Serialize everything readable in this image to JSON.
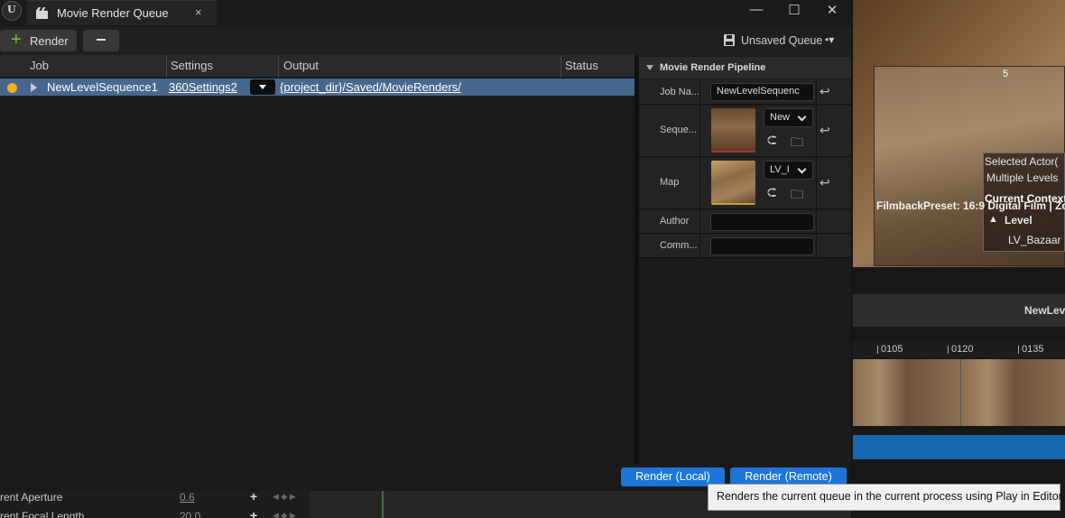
{
  "window": {
    "tab_title": "Movie Render Queue",
    "close_glyph": "×",
    "minimize_glyph": "—",
    "maximize_glyph": "☐",
    "winclose_glyph": "✕"
  },
  "toolbar": {
    "render_label": "Render",
    "queue_name": "Unsaved Queue",
    "queue_suffix": "•▾"
  },
  "columns": {
    "job": "Job",
    "settings": "Settings",
    "output": "Output",
    "status": "Status"
  },
  "jobs": [
    {
      "name": "NewLevelSequence1",
      "settings": "360Settings2",
      "output": "{project_dir}/Saved/MovieRenders/",
      "status": ""
    }
  ],
  "pipeline": {
    "title": "Movie Render Pipeline",
    "job_name_label": "Job Na...",
    "job_name_value": "NewLevelSequenc",
    "sequence_label": "Seque...",
    "sequence_value": "New",
    "map_label": "Map",
    "map_value": "LV_I",
    "author_label": "Author",
    "author_value": "",
    "comment_label": "Comm...",
    "comment_value": ""
  },
  "footer": {
    "render_local": "Render (Local)",
    "render_remote": "Render (Remote)"
  },
  "tooltip": "Renders the current queue in the current process using Play in Editor.",
  "bottom_rows": [
    {
      "label": "rent Aperture",
      "value": "0.6"
    },
    {
      "label": "rent Focal Length",
      "value": "20.0"
    }
  ],
  "viewport": {
    "frame_number": "5",
    "selected_actor": "Selected Actor(",
    "multiple_levels": "Multiple Levels",
    "current_context": "Current Context",
    "filmback": "FilmbackPreset: 16:9 Digital Film | Zo",
    "level_label": "Level",
    "level_name": "LV_Bazaar"
  },
  "sequencer": {
    "header": "NewLev",
    "ticks": [
      "0105",
      "0120",
      "0135"
    ]
  },
  "colors": {
    "accent": "#1c75d8",
    "selected_row": "#48678f",
    "status_dot": "#f2b21b"
  }
}
